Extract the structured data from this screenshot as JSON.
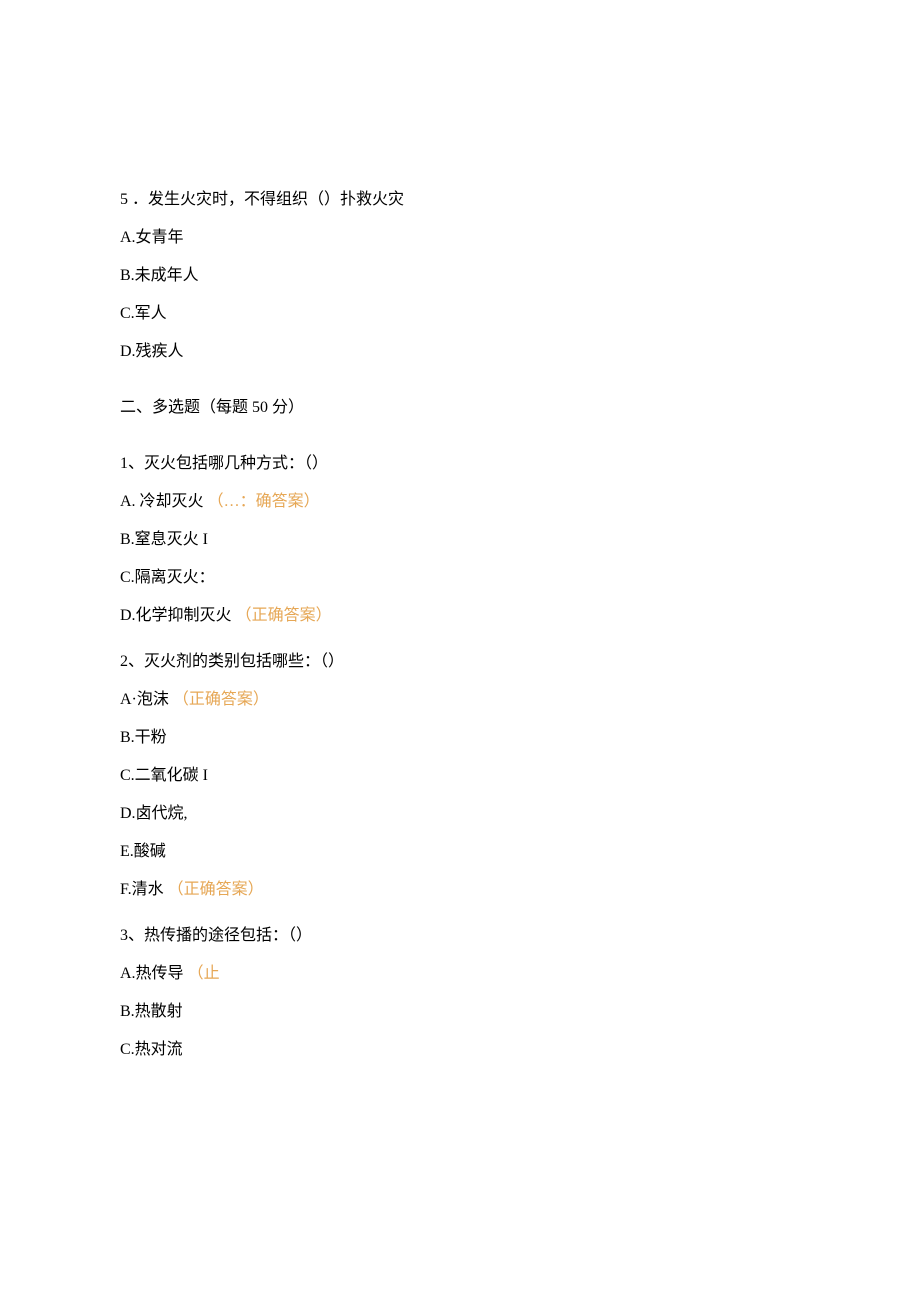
{
  "single_q5": {
    "stem": "5 ．发生火灾时，不得组织（）扑救火灾",
    "options": {
      "a": "A.女青年",
      "b": "B.未成年人",
      "c": "C.军人",
      "d": "D.残疾人"
    }
  },
  "section2_header": "二、多选题（每题 50 分）",
  "multi_q1": {
    "stem": "1、灭火包括哪几种方式：（）",
    "a_text": "A. 冷却灭火 ",
    "a_correct": "（…：确答案）",
    "b": "B.窒息灭火 I",
    "c": "C.隔离灭火：",
    "d_text": "D.化学抑制灭火 ",
    "d_correct": "（正确答案）"
  },
  "multi_q2": {
    "stem": "2、灭火剂的类别包括哪些：（）",
    "a_text": "A·泡沫 ",
    "a_correct": "（正确答案）",
    "b": "B.干粉",
    "c": "C.二氧化碳 I",
    "d": "D.卤代烷,",
    "e": "E.酸碱",
    "f_text": "F.清水 ",
    "f_correct": "（正确答案）"
  },
  "multi_q3": {
    "stem": "3、热传播的途径包括：（）",
    "a_text": "A.热传导 ",
    "a_correct": "（止",
    "b": "B.热散射",
    "c": "C.热对流"
  }
}
